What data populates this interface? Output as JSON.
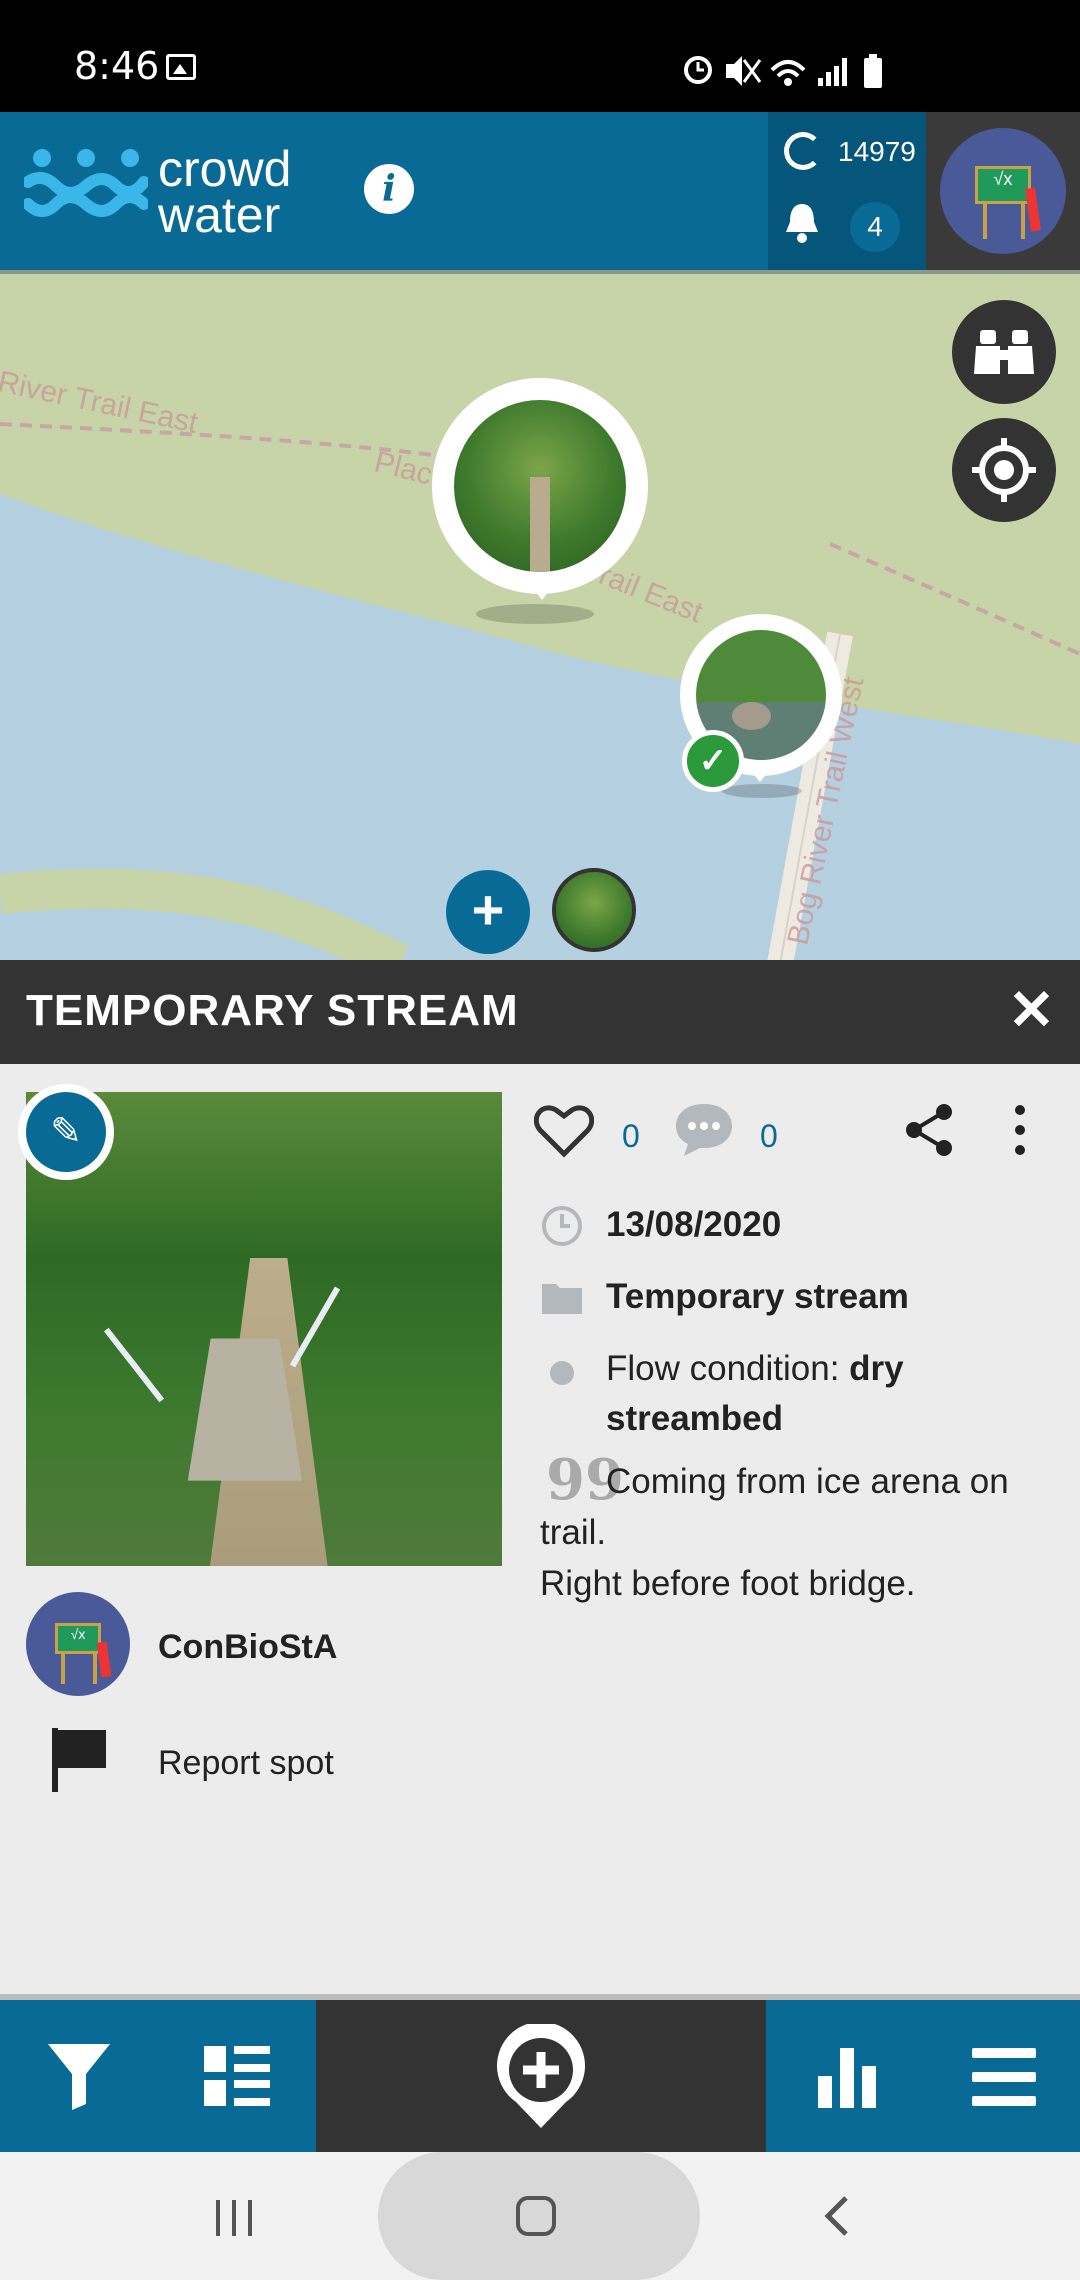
{
  "status_bar": {
    "time": "8:46"
  },
  "header": {
    "logo_line1": "crowd",
    "logo_line2": "water",
    "info_label": "i",
    "score": "14979",
    "notifications": "4"
  },
  "map": {
    "road_labels": [
      "River Trail East",
      "Plac",
      "Trail East",
      "Bog River Trail West"
    ],
    "add_label": "+",
    "check_label": "✓"
  },
  "panel": {
    "title": "TEMPORARY STREAM",
    "close_label": "✕",
    "likes": "0",
    "comments": "0",
    "date": "13/08/2020",
    "category": "Temporary stream",
    "flow_label": "Flow condition: ",
    "flow_value": "dry streambed",
    "quote_mark": "99",
    "comment_text": "Coming from ice arena on trail.",
    "comment_text2": "Right before foot bridge.",
    "username": "ConBioStA",
    "report_label": "Report spot",
    "edit_label": "✎"
  },
  "colors": {
    "primary": "#0a6a96",
    "dark": "#333333",
    "map_land": "#c6d4a8",
    "map_water": "#b5d0e0",
    "check_green": "#2a9a3a"
  }
}
